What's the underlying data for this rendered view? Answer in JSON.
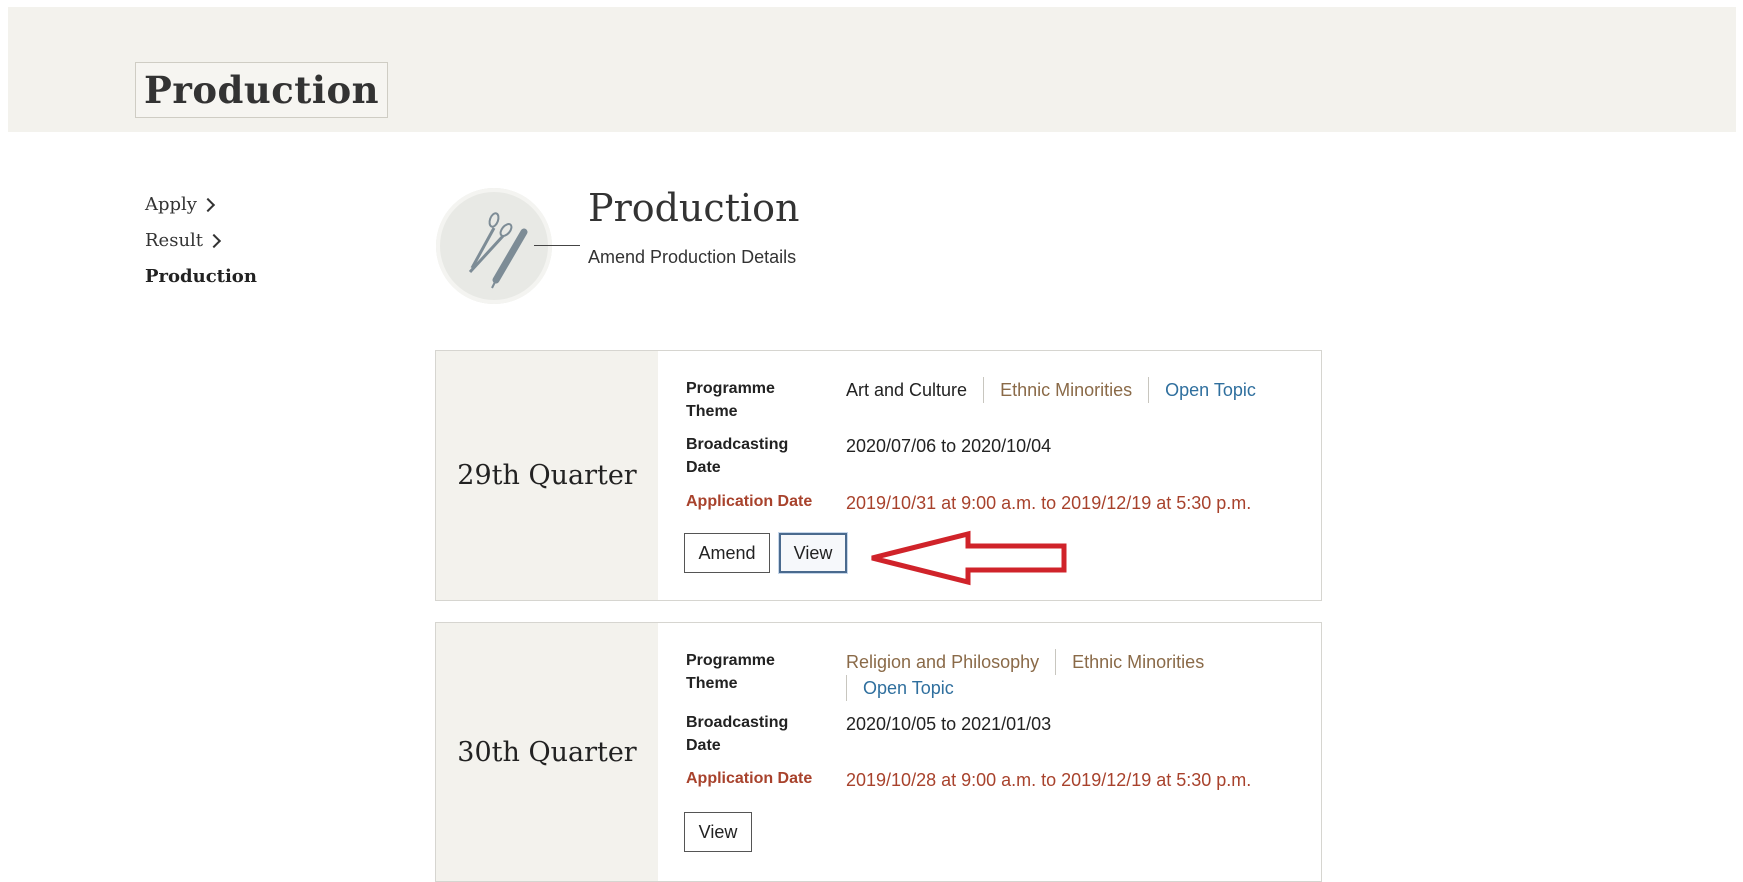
{
  "banner": {
    "title": "Production"
  },
  "sidenav": {
    "items": [
      {
        "label": "Apply",
        "active": false,
        "chevron": true
      },
      {
        "label": "Result",
        "active": false,
        "chevron": true
      },
      {
        "label": "Production",
        "active": true,
        "chevron": false
      }
    ]
  },
  "header": {
    "icon": "scissors-pen-icon",
    "title": "Production",
    "subtitle": "Amend Production Details"
  },
  "cards": [
    {
      "quarter": "29th Quarter",
      "programme_theme_label": "Programme Theme",
      "themes": [
        "Art and Culture",
        "Ethnic Minorities",
        "Open Topic"
      ],
      "broadcasting_label": "Broadcasting Date",
      "broadcasting_value": "2020/07/06 to 2020/10/04",
      "application_label": "Application Date",
      "application_value": "2019/10/31 at 9:00 a.m. to 2019/12/19 at 5:30 p.m.",
      "buttons": [
        "Amend",
        "View"
      ]
    },
    {
      "quarter": "30th Quarter",
      "programme_theme_label": "Programme Theme",
      "themes": [
        "Religion and Philosophy",
        "Ethnic Minorities",
        "Open Topic"
      ],
      "broadcasting_label": "Broadcasting Date",
      "broadcasting_value": "2020/10/05 to 2021/01/03",
      "application_label": "Application Date",
      "application_value": "2019/10/28 at 9:00 a.m. to 2019/12/19 at 5:30 p.m.",
      "buttons": [
        "View"
      ]
    }
  ],
  "annotation": {
    "arrow_color": "#d0232a",
    "points_to": "View"
  },
  "colors": {
    "banner_bg": "#f3f2ed",
    "application_date": "#a8422c",
    "theme_brown": "#8a6a48",
    "theme_blue": "#2f6f9e"
  }
}
